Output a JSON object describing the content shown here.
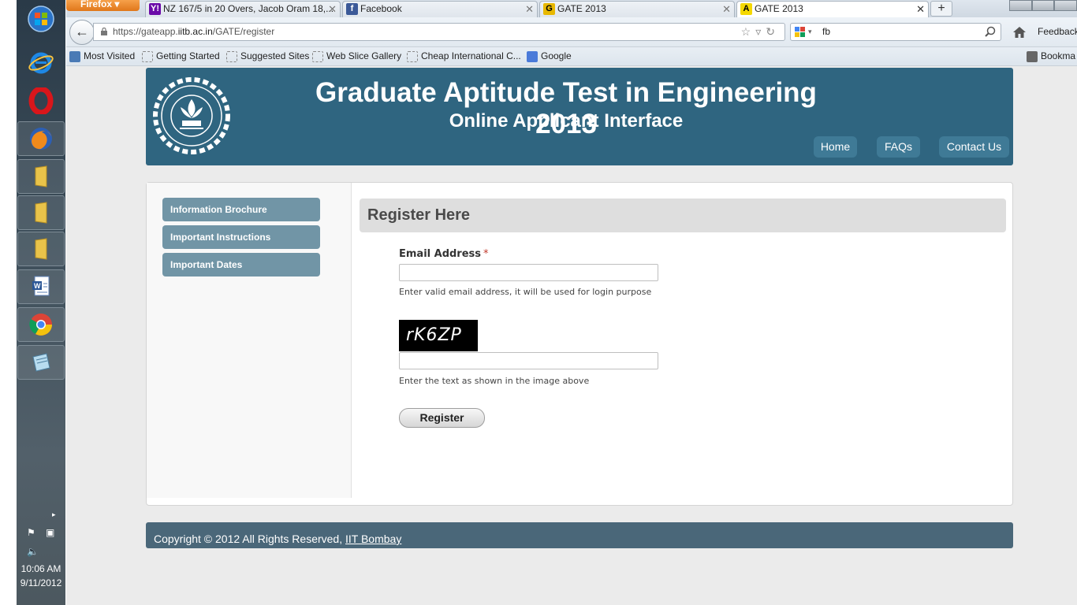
{
  "taskbar": {
    "time": "10:06 AM",
    "date": "9/11/2012"
  },
  "browser": {
    "app_button": "Firefox",
    "tabs": [
      {
        "label": "NZ 167/5 in 20 Overs, Jacob Oram 18,...",
        "favicon": "yahoo-icon",
        "color": "#6b0aa8",
        "active": false
      },
      {
        "label": "Facebook",
        "favicon": "facebook-icon",
        "color": "#3b5998",
        "active": false
      },
      {
        "label": "GATE 2013",
        "favicon": "g-icon",
        "color": "#d4a800",
        "active": false
      },
      {
        "label": "GATE 2013",
        "favicon": "a-icon",
        "color": "#f5d800",
        "active": true
      }
    ],
    "url_prefix": "https://gateapp.",
    "url_host": "iitb.ac.in",
    "url_path": "/GATE/register",
    "search_value": "fb",
    "feedback": "Feedback",
    "bookmarks": [
      "Most Visited",
      "Getting Started",
      "Suggested Sites",
      "Web Slice Gallery",
      "Cheap International C...",
      "Google"
    ],
    "bookmarks_menu": "Bookma"
  },
  "header": {
    "title": "Graduate Aptitude Test in Engineering 2013",
    "subtitle": "Online Applicant Interface",
    "nav": [
      "Home",
      "FAQs",
      "Contact Us"
    ],
    "color": "#2f6580"
  },
  "sidebar": {
    "items": [
      "Information Brochure",
      "Important Instructions",
      "Important Dates"
    ]
  },
  "form": {
    "heading": "Register Here",
    "email_label": "Email Address",
    "required_mark": "*",
    "email_value": "",
    "email_hint": "Enter valid email address, it will be used for login purpose",
    "captcha_text": "rK6ZP",
    "captcha_value": "",
    "captcha_hint": "Enter the text as shown in the image above",
    "submit_label": "Register"
  },
  "footer": {
    "text": "Copyright © 2012 All Rights Reserved,",
    "link": "IIT Bombay"
  }
}
